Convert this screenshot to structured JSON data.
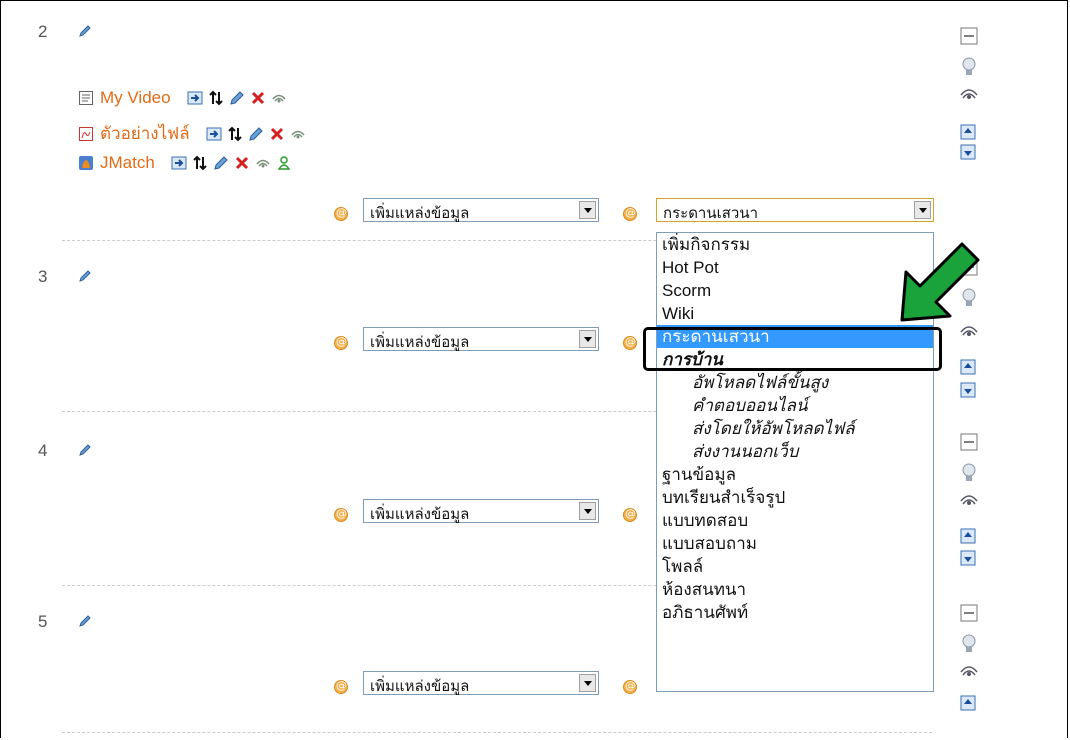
{
  "sections": [
    {
      "number": "2"
    },
    {
      "number": "3"
    },
    {
      "number": "4"
    },
    {
      "number": "5"
    }
  ],
  "resources": [
    {
      "label": "My Video",
      "icon": "page-icon"
    },
    {
      "label": "ตัวอย่างไฟล์",
      "icon": "pdf-icon"
    },
    {
      "label": "JMatch",
      "icon": "hotpot-icon"
    }
  ],
  "add_resource_select": {
    "value": "เพิ่มแหล่งข้อมูล"
  },
  "add_activity_select": {
    "value": "กระดานเสวนา"
  },
  "activity_options": [
    {
      "label": "เพิ่มกิจกรรม",
      "kind": "normal"
    },
    {
      "label": "Hot Pot",
      "kind": "normal"
    },
    {
      "label": "Scorm",
      "kind": "normal"
    },
    {
      "label": "Wiki",
      "kind": "normal"
    },
    {
      "label": "กระดานเสวนา",
      "kind": "highlighted"
    },
    {
      "label": "การบ้าน",
      "kind": "group"
    },
    {
      "label": "อัพโหลดไฟล์ขั้นสูง",
      "kind": "sub"
    },
    {
      "label": "คำตอบออนไลน์",
      "kind": "sub"
    },
    {
      "label": "ส่งโดยให้อัพโหลดไฟล์",
      "kind": "sub"
    },
    {
      "label": "ส่งงานนอกเว็บ",
      "kind": "sub"
    },
    {
      "label": "ฐานข้อมูล",
      "kind": "normal"
    },
    {
      "label": "บทเรียนสำเร็จรูป",
      "kind": "normal"
    },
    {
      "label": "แบบทดสอบ",
      "kind": "normal"
    },
    {
      "label": "แบบสอบถาม",
      "kind": "normal"
    },
    {
      "label": "โพลล์",
      "kind": "normal"
    },
    {
      "label": "ห้องสนทนา",
      "kind": "normal"
    },
    {
      "label": "อภิธานศัพท์",
      "kind": "normal"
    }
  ],
  "colors": {
    "link": "#e26b16",
    "highlight": "#3399ff",
    "arrow": "#1aa33a"
  }
}
